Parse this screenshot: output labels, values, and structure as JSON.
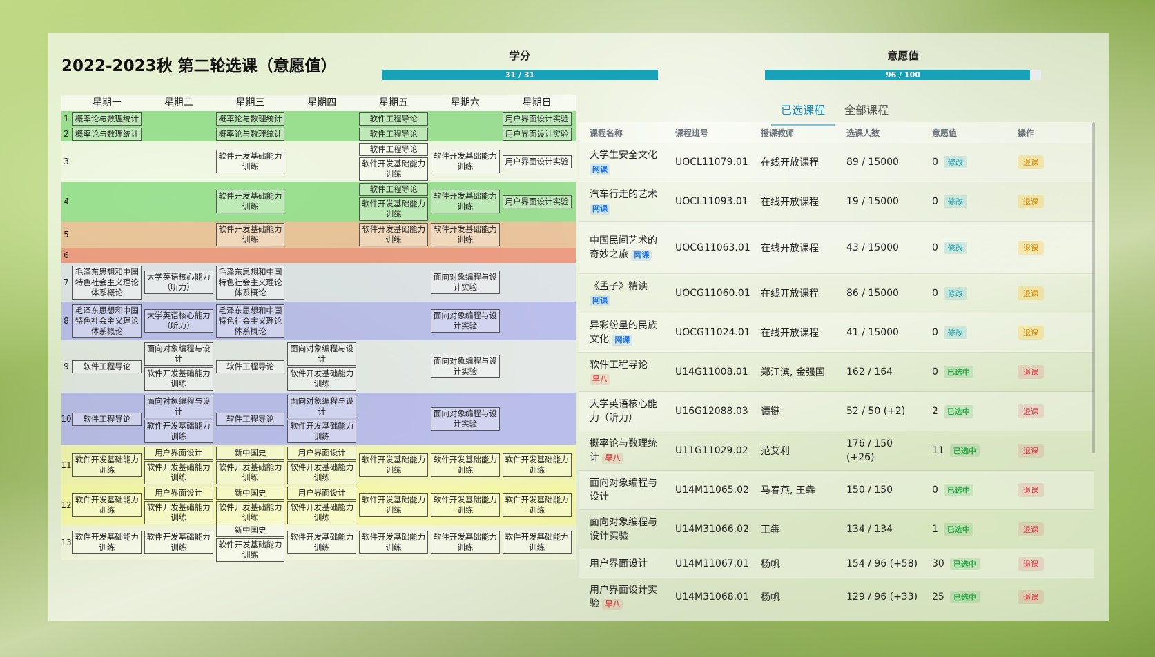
{
  "title": "2022-2023秋 第二轮选课（意愿值）",
  "credits": {
    "label": "学分",
    "text": "31 / 31",
    "fraction": 1.0
  },
  "willingness": {
    "label": "意愿值",
    "text": "96 / 100",
    "fraction": 0.96
  },
  "days": [
    "星期一",
    "星期二",
    "星期三",
    "星期四",
    "星期五",
    "星期六",
    "星期日"
  ],
  "rows": [
    {
      "num": "1",
      "cells": [
        [
          "概率论与数理统计"
        ],
        [],
        [
          "概率论与数理统计"
        ],
        [],
        [
          "软件工程导论"
        ],
        [],
        [
          "用户界面设计实验"
        ]
      ]
    },
    {
      "num": "2",
      "cells": [
        [
          "概率论与数理统计"
        ],
        [],
        [
          "概率论与数理统计"
        ],
        [],
        [
          "软件工程导论"
        ],
        [],
        [
          "用户界面设计实验"
        ]
      ]
    },
    {
      "num": "3",
      "cells": [
        [],
        [],
        [
          "软件开发基础能力训练"
        ],
        [],
        [
          "软件工程导论",
          "软件开发基础能力训练"
        ],
        [
          "软件开发基础能力训练"
        ],
        [
          "用户界面设计实验"
        ]
      ]
    },
    {
      "num": "4",
      "cells": [
        [],
        [],
        [
          "软件开发基础能力训练"
        ],
        [],
        [
          "软件工程导论",
          "软件开发基础能力训练"
        ],
        [
          "软件开发基础能力训练"
        ],
        [
          "用户界面设计实验"
        ]
      ]
    },
    {
      "num": "5",
      "cells": [
        [],
        [],
        [
          "软件开发基础能力训练"
        ],
        [],
        [
          "软件开发基础能力训练"
        ],
        [
          "软件开发基础能力训练"
        ],
        []
      ]
    },
    {
      "num": "6",
      "cells": [
        [],
        [],
        [],
        [],
        [],
        [],
        []
      ]
    },
    {
      "num": "7",
      "cells": [
        [
          "毛泽东思想和中国特色社会主义理论体系概论"
        ],
        [
          "大学英语核心能力（听力）"
        ],
        [
          "毛泽东思想和中国特色社会主义理论体系概论"
        ],
        [],
        [],
        [
          "面向对象编程与设计实验"
        ],
        []
      ]
    },
    {
      "num": "8",
      "cells": [
        [
          "毛泽东思想和中国特色社会主义理论体系概论"
        ],
        [
          "大学英语核心能力（听力）"
        ],
        [
          "毛泽东思想和中国特色社会主义理论体系概论"
        ],
        [],
        [],
        [
          "面向对象编程与设计实验"
        ],
        []
      ]
    },
    {
      "num": "9",
      "cells": [
        [
          "软件工程导论"
        ],
        [
          "面向对象编程与设计",
          "软件开发基础能力训练"
        ],
        [
          "软件工程导论"
        ],
        [
          "面向对象编程与设计",
          "软件开发基础能力训练"
        ],
        [],
        [
          "面向对象编程与设计实验"
        ],
        []
      ]
    },
    {
      "num": "10",
      "cells": [
        [
          "软件工程导论"
        ],
        [
          "面向对象编程与设计",
          "软件开发基础能力训练"
        ],
        [
          "软件工程导论"
        ],
        [
          "面向对象编程与设计",
          "软件开发基础能力训练"
        ],
        [],
        [
          "面向对象编程与设计实验"
        ],
        []
      ]
    },
    {
      "num": "11",
      "cells": [
        [
          "软件开发基础能力训练"
        ],
        [
          "用户界面设计",
          "软件开发基础能力训练"
        ],
        [
          "新中国史",
          "软件开发基础能力训练"
        ],
        [
          "用户界面设计",
          "软件开发基础能力训练"
        ],
        [
          "软件开发基础能力训练"
        ],
        [
          "软件开发基础能力训练"
        ],
        [
          "软件开发基础能力训练"
        ]
      ]
    },
    {
      "num": "12",
      "cells": [
        [
          "软件开发基础能力训练"
        ],
        [
          "用户界面设计",
          "软件开发基础能力训练"
        ],
        [
          "新中国史",
          "软件开发基础能力训练"
        ],
        [
          "用户界面设计",
          "软件开发基础能力训练"
        ],
        [
          "软件开发基础能力训练"
        ],
        [
          "软件开发基础能力训练"
        ],
        [
          "软件开发基础能力训练"
        ]
      ]
    },
    {
      "num": "13",
      "cells": [
        [
          "软件开发基础能力训练"
        ],
        [
          "软件开发基础能力训练"
        ],
        [
          "新中国史",
          "软件开发基础能力训练"
        ],
        [
          "软件开发基础能力训练"
        ],
        [
          "软件开发基础能力训练"
        ],
        [
          "软件开发基础能力训练"
        ],
        [
          "软件开发基础能力训练"
        ]
      ]
    }
  ],
  "row_colors": [
    "rgba(60,200,60,0.45)",
    "rgba(60,200,60,0.45)",
    "rgba(255,255,255,0.25)",
    "rgba(60,200,60,0.45)",
    "rgba(230,140,80,0.45)",
    "rgba(235,90,60,0.55)",
    "rgba(200,200,255,0.35)",
    "rgba(130,130,255,0.45)",
    "rgba(220,220,255,0.35)",
    "rgba(130,130,255,0.45)",
    "rgba(255,255,120,0.4)",
    "rgba(255,255,120,0.5)",
    "rgba(255,255,220,0.35)"
  ],
  "tabs": [
    "已选课程",
    "全部课程"
  ],
  "table_headers": [
    "课程名称",
    "课程班号",
    "授课教师",
    "选课人数",
    "意愿值",
    "操作"
  ],
  "courses": [
    {
      "name": "大学生安全文化",
      "tag": "网课",
      "tag_type": "net",
      "code": "UOCL11079.01",
      "teacher": "在线开放课程",
      "count": "89 / 15000",
      "count_color": "green",
      "will": "0",
      "status": "修改",
      "status_type": "edit",
      "action": "退课",
      "action_type": "yellow"
    },
    {
      "name": "汽车行走的艺术",
      "tag": "网课",
      "tag_type": "net",
      "code": "UOCL11093.01",
      "teacher": "在线开放课程",
      "count": "19 / 15000",
      "count_color": "green",
      "will": "0",
      "status": "修改",
      "status_type": "edit",
      "action": "退课",
      "action_type": "yellow"
    },
    {
      "name": "中国民间艺术的奇妙之旅",
      "tag": "网课",
      "tag_type": "net",
      "code": "UOCG11063.01",
      "teacher": "在线开放课程",
      "count": "43 / 15000",
      "count_color": "green",
      "will": "0",
      "status": "修改",
      "status_type": "edit",
      "action": "退课",
      "action_type": "yellow"
    },
    {
      "name": "《孟子》精读",
      "tag": "网课",
      "tag_type": "net",
      "code": "UOCG11060.01",
      "teacher": "在线开放课程",
      "count": "86 / 15000",
      "count_color": "green",
      "will": "0",
      "status": "修改",
      "status_type": "edit",
      "action": "退课",
      "action_type": "yellow"
    },
    {
      "name": "异彩纷呈的民族文化",
      "tag": "网课",
      "tag_type": "net",
      "code": "UOCG11024.01",
      "teacher": "在线开放课程",
      "count": "41 / 15000",
      "count_color": "green",
      "will": "0",
      "status": "修改",
      "status_type": "edit",
      "action": "退课",
      "action_type": "yellow"
    },
    {
      "name": "软件工程导论",
      "tag": "早八",
      "tag_type": "early",
      "code": "U14G11008.01",
      "teacher": "郑江滨, 金强国",
      "count": "162 / 164",
      "count_color": "green",
      "will": "0",
      "status": "已选中",
      "status_type": "sel",
      "action": "退课",
      "action_type": "red"
    },
    {
      "name": "大学英语核心能力（听力）",
      "tag": "",
      "tag_type": "",
      "code": "U16G12088.03",
      "teacher": "谭键",
      "count": "52 / 50 (+2)",
      "count_color": "red",
      "will": "2",
      "status": "已选中",
      "status_type": "sel",
      "action": "退课",
      "action_type": "red"
    },
    {
      "name": "概率论与数理统计",
      "tag": "早八",
      "tag_type": "early",
      "code": "U11G11029.02",
      "teacher": "范艾利",
      "count": "176 / 150 (+26)",
      "count_color": "red",
      "will": "11",
      "status": "已选中",
      "status_type": "sel",
      "action": "退课",
      "action_type": "red"
    },
    {
      "name": "面向对象编程与设计",
      "tag": "",
      "tag_type": "",
      "code": "U14M11065.02",
      "teacher": "马春燕, 王犇",
      "count": "150 / 150",
      "count_color": "green",
      "will": "0",
      "status": "已选中",
      "status_type": "sel",
      "action": "退课",
      "action_type": "red"
    },
    {
      "name": "面向对象编程与设计实验",
      "tag": "",
      "tag_type": "",
      "code": "U14M31066.02",
      "teacher": "王犇",
      "count": "134 / 134",
      "count_color": "green",
      "will": "1",
      "status": "已选中",
      "status_type": "sel",
      "action": "退课",
      "action_type": "red"
    },
    {
      "name": "用户界面设计",
      "tag": "",
      "tag_type": "",
      "code": "U14M11067.01",
      "teacher": "杨帆",
      "count": "154 / 96 (+58)",
      "count_color": "red",
      "will": "30",
      "status": "已选中",
      "status_type": "sel",
      "action": "退课",
      "action_type": "red"
    },
    {
      "name": "用户界面设计实验",
      "tag": "早八",
      "tag_type": "early",
      "code": "U14M31068.01",
      "teacher": "杨帆",
      "count": "129 / 96 (+33)",
      "count_color": "red",
      "will": "25",
      "status": "已选中",
      "status_type": "sel",
      "action": "退课",
      "action_type": "red"
    }
  ]
}
